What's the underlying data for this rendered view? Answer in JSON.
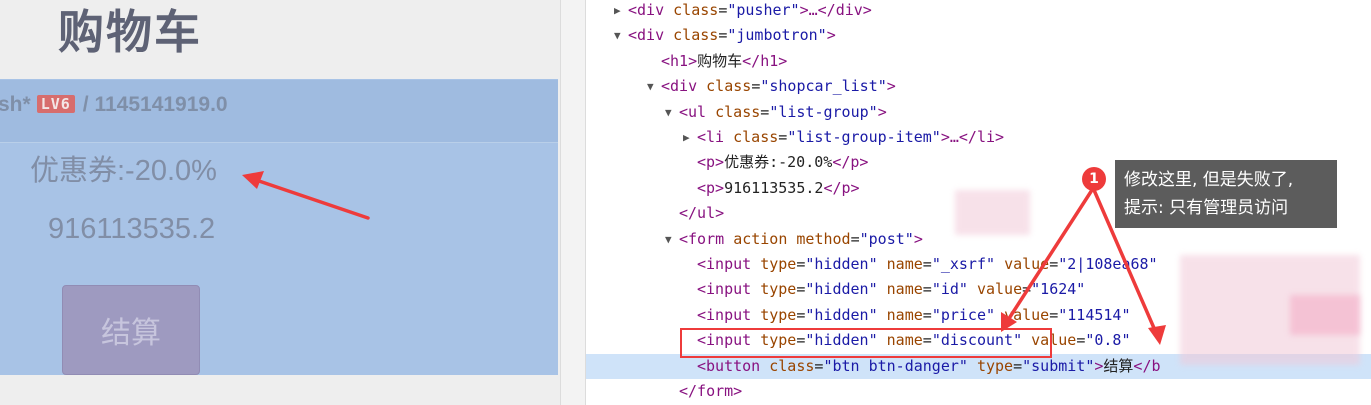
{
  "left_page": {
    "title": "购物车",
    "item": {
      "name": "sh*",
      "level": "LV6",
      "price": "/ 1145141919.0"
    },
    "coupon": "优惠券:-20.0%",
    "total": "916113535.2",
    "checkout_label": "结算"
  },
  "devtools": {
    "rows": [
      {
        "parts": [
          "<",
          "div",
          " ",
          "class",
          "=\"",
          "pusher",
          "\">…</",
          "div",
          ">"
        ]
      },
      {
        "parts": [
          "<",
          "div",
          " ",
          "class",
          "=\"",
          "jumbotron",
          "\">"
        ]
      },
      {
        "text": [
          "<h1>",
          "购物车",
          "</h1>"
        ]
      },
      {
        "parts": [
          "<",
          "div",
          " ",
          "class",
          "=\"",
          "shopcar_list",
          "\">"
        ]
      },
      {
        "parts": [
          "<",
          "ul",
          " ",
          "class",
          "=\"",
          "list-group",
          "\">"
        ]
      },
      {
        "parts": [
          "<",
          "li",
          " ",
          "class",
          "=\"",
          "list-group-item",
          "\">…</",
          "li",
          ">"
        ]
      },
      {
        "text": [
          "<p>",
          "优惠券:-20.0%",
          "</p>"
        ]
      },
      {
        "text": [
          "<p>",
          "916113535.2",
          "</p>"
        ]
      },
      {
        "text": [
          "</ul>",
          "",
          ""
        ]
      },
      {
        "parts": [
          "<",
          "form",
          " ",
          "action method",
          "=\"",
          "post",
          "\">"
        ]
      },
      {
        "input": {
          "type": "hidden",
          "name": "_xsrf",
          "value": "2|108ea68"
        }
      },
      {
        "input": {
          "type": "hidden",
          "name": "id",
          "value": "1624"
        }
      },
      {
        "input": {
          "type": "hidden",
          "name": "price",
          "value": "114514"
        }
      },
      {
        "input": {
          "type": "hidden",
          "name": "discount",
          "value": "0.8"
        }
      },
      {
        "button": {
          "class": "btn btn-danger",
          "type": "submit",
          "label": "结算"
        }
      },
      {
        "text": [
          "</form>",
          "",
          ""
        ]
      }
    ],
    "ellipsis": "…"
  },
  "annotation": {
    "badge": "1",
    "line1": "修改这里, 但是失败了,",
    "line2": "提示: 只有管理员访问"
  },
  "colors": {
    "annotation_red": "#ee3b3b",
    "selected_row": "#cfe3f9",
    "tag": "#881280",
    "attr": "#994500",
    "value": "#1a1aa6"
  }
}
